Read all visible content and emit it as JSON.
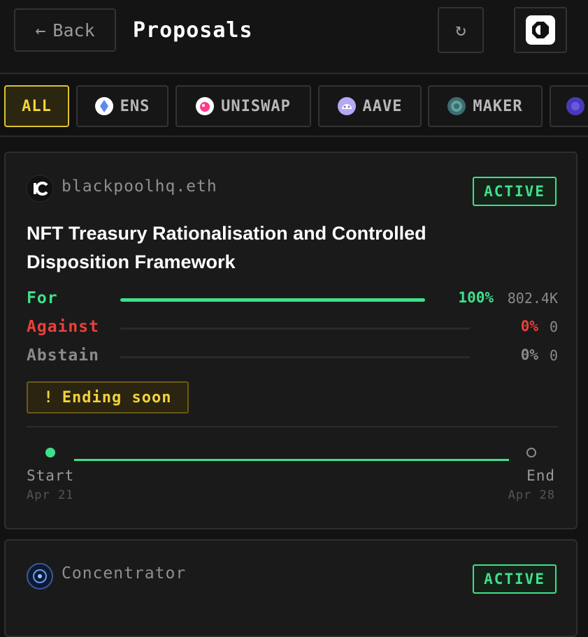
{
  "header": {
    "back_label": "Back",
    "title": "Proposals"
  },
  "filters": [
    {
      "label": "ALL",
      "active": true
    },
    {
      "label": "ENS",
      "icon": "ens-icon"
    },
    {
      "label": "UNISWAP",
      "icon": "uniswap-icon"
    },
    {
      "label": "AAVE",
      "icon": "aave-icon"
    },
    {
      "label": "MAKER",
      "icon": "maker-icon"
    }
  ],
  "proposals": [
    {
      "author": "blackpoolhq.eth",
      "status": "ACTIVE",
      "title": "NFT Treasury Rationalisation and Controlled Disposition Framework",
      "votes": [
        {
          "label": "For",
          "pct": "100%",
          "count": "802.4K",
          "fraction": 1.0,
          "color": "#3fe08a"
        },
        {
          "label": "Against",
          "pct": "0%",
          "count": "0",
          "fraction": 0,
          "color": "#e8413a"
        },
        {
          "label": "Abstain",
          "pct": "0%",
          "count": "0",
          "fraction": 0,
          "color": "#8a8a8a"
        }
      ],
      "notice": "Ending soon",
      "timeline": {
        "start_label": "Start",
        "start_date": "Apr 21",
        "end_label": "End",
        "end_date": "Apr 28"
      }
    },
    {
      "author": "Concentrator",
      "status": "ACTIVE"
    }
  ],
  "colors": {
    "accent_yellow": "#f2d33a",
    "active_green": "#3fe08a",
    "against_red": "#e8413a"
  }
}
